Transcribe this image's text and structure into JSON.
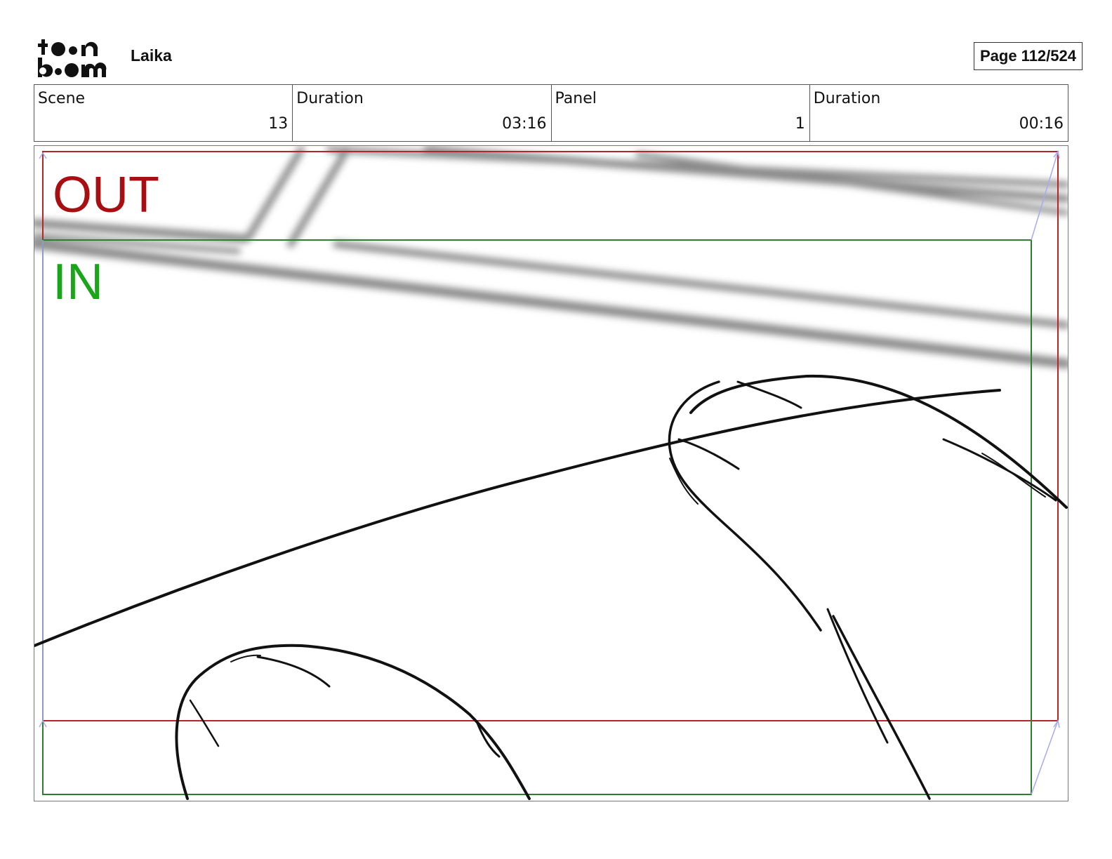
{
  "header": {
    "logo_icon": "toonboom-logo",
    "project_name": "Laika",
    "page_label": "Page 112/524"
  },
  "info": [
    {
      "label": "Scene",
      "value": "13"
    },
    {
      "label": "Duration",
      "value": "03:16"
    },
    {
      "label": "Panel",
      "value": "1"
    },
    {
      "label": "Duration",
      "value": "00:16"
    }
  ],
  "panel": {
    "out_label": "OUT",
    "in_label": "IN",
    "colors": {
      "out_frame": "#b3262b",
      "in_frame": "#2e7d32",
      "guide": "#a9a9f2"
    }
  }
}
